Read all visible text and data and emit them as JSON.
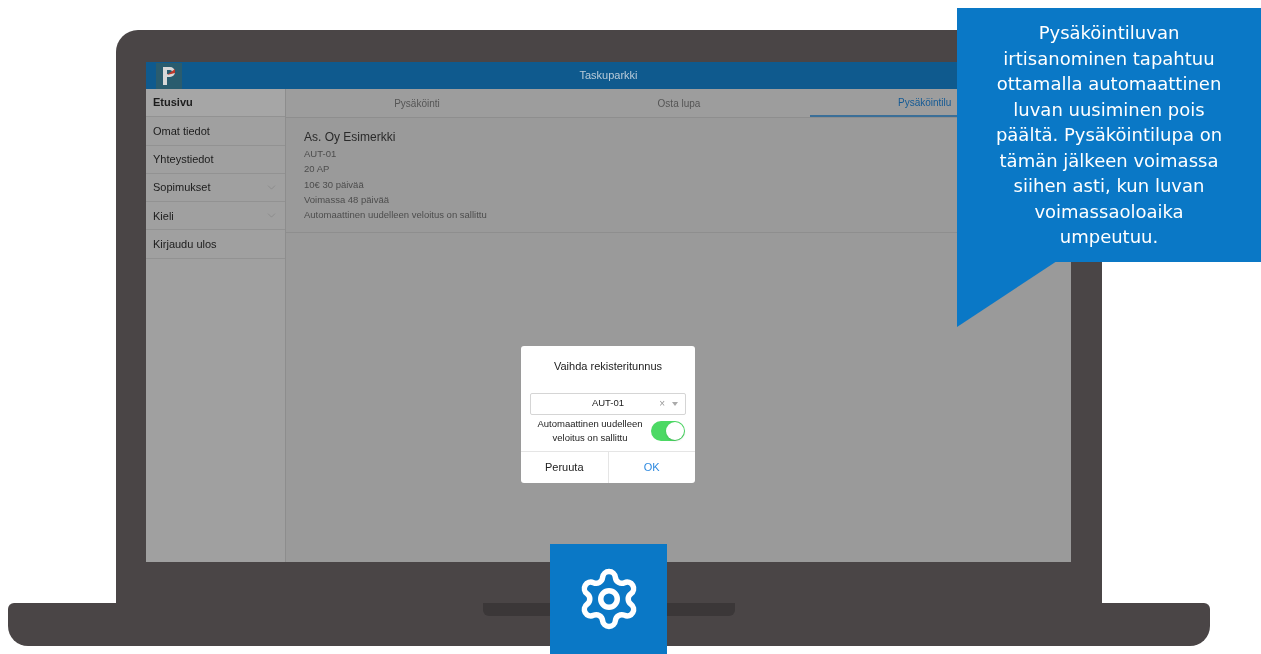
{
  "app": {
    "title": "Taskuparkki"
  },
  "sidebar": {
    "items": [
      {
        "label": "Etusivu",
        "selected": true,
        "expandable": false
      },
      {
        "label": "Omat tiedot",
        "selected": false,
        "expandable": false
      },
      {
        "label": "Yhteystiedot",
        "selected": false,
        "expandable": false
      },
      {
        "label": "Sopimukset",
        "selected": false,
        "expandable": true
      },
      {
        "label": "Kieli",
        "selected": false,
        "expandable": true
      },
      {
        "label": "Kirjaudu ulos",
        "selected": false,
        "expandable": false
      }
    ]
  },
  "tabs": [
    {
      "label": "Pysäköinti",
      "selected": false
    },
    {
      "label": "Osta lupa",
      "selected": false
    },
    {
      "label": "Pysäköintilu",
      "selected": true
    }
  ],
  "permit": {
    "title": "As. Oy Esimerkki",
    "lines": [
      "AUT-01",
      "20 AP",
      "10€ 30 päivää",
      "Voimassa 48 päivää",
      "Automaattinen uudelleen veloitus on sallittu"
    ]
  },
  "dialog": {
    "title": "Vaihda rekisteritunnus",
    "select_value": "AUT-01",
    "clear": "×",
    "toggle_label": "Automaattinen uudelleen veloitus on sallittu",
    "toggle_on": true,
    "buttons": [
      "Peruuta",
      "OK"
    ]
  },
  "callout": {
    "text": "Pysäköintiluvan irtisanominen tapahtuu ottamalla automaattinen luvan uusiminen pois päältä. Pysäköintilupa on tämän jälkeen voimassa siihen asti, kun luvan voimassaoloaika umpeutuu."
  }
}
